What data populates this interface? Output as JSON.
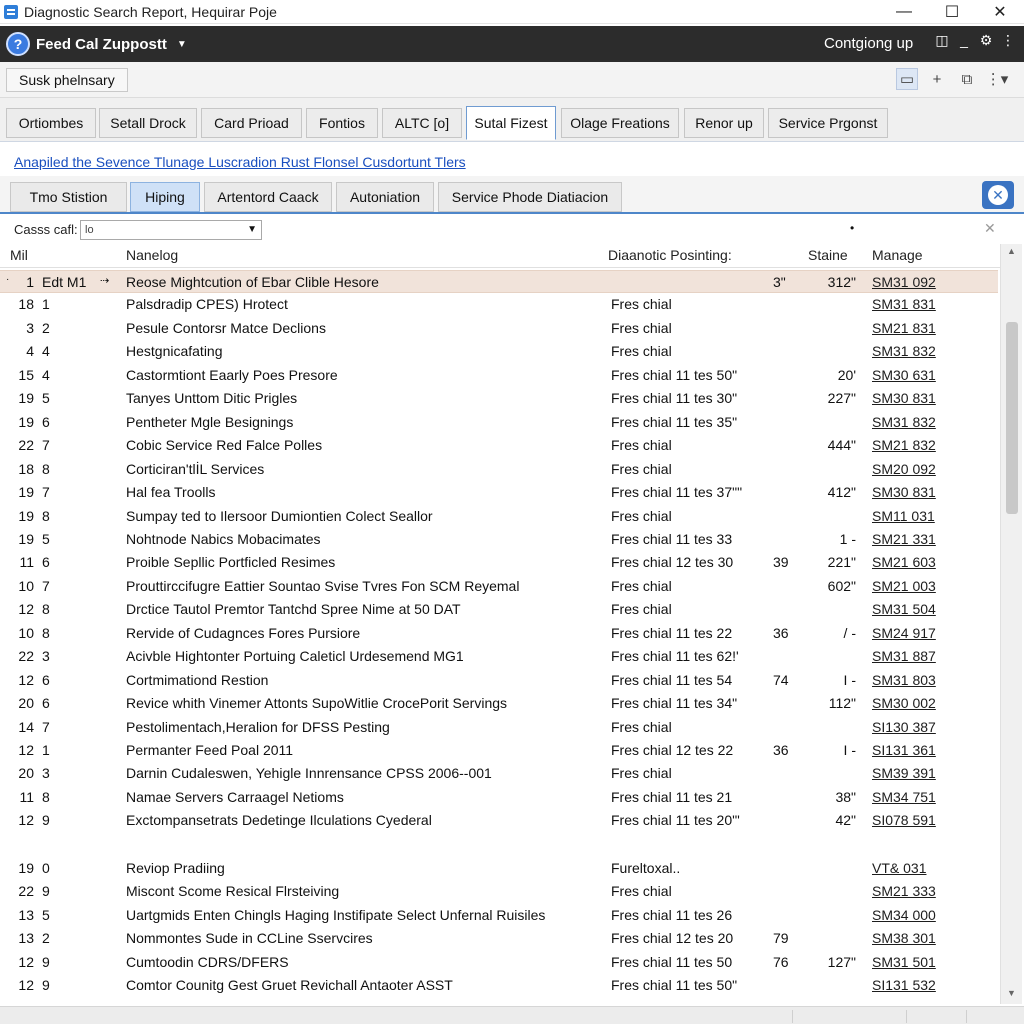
{
  "window": {
    "title": "Diagnostic Search Report, Hequirar Poje",
    "buttons": [
      "—",
      "☐",
      "✕"
    ]
  },
  "appbar": {
    "app_name": "Feed Cal Zuppostt",
    "right_text": "Contgiong up"
  },
  "toolbar": {
    "search_chip": "Susk phelnsary"
  },
  "main_tabs": [
    "Ortiombes",
    "Setall Drock",
    "Card Prioad",
    "Fontios",
    "ALTC [o]",
    "Sutal Fizest",
    "Olage Freations",
    "Renor up",
    "Service Prgonst"
  ],
  "main_tab_active": "Sutal Fizest",
  "link": "Anapiled the Sevence Tlunage Luscradion Rust Flonsel Cusdortunt Tlers",
  "sub_tabs": [
    "Tmo Stistion",
    "Hiping",
    "Artentord Caack",
    "Autoniation",
    "Service Phode Diatiacion"
  ],
  "sub_tab_active": "Hiping",
  "filter": {
    "label": "Casss cafl:",
    "value": "lo"
  },
  "columns": {
    "mil": "Mil",
    "name": "Nanelog",
    "diag": "Diaanotic Posinting:",
    "status": "Staine",
    "manage": "Manage"
  },
  "rows": [
    {
      "a": "1",
      "b": "Edt M1",
      "name": "Reose Mightcution of Ebar Clible Hesore",
      "diag": "",
      "c": "3\"",
      "d": "312\"",
      "manage": "SM31 092"
    },
    {
      "a": "18",
      "b": "1",
      "name": "Palsdradip CPES) Hrotect",
      "diag": "Fres chial",
      "c": "",
      "d": "",
      "manage": "SM31 831"
    },
    {
      "a": "3",
      "b": "2",
      "name": "Pesule Contorsr Matce Declions",
      "diag": "Fres chial",
      "c": "",
      "d": "",
      "manage": "SM21 831"
    },
    {
      "a": "4",
      "b": "4",
      "name": "Hestgnicafating",
      "diag": "Fres chial",
      "c": "",
      "d": "",
      "manage": "SM31 832"
    },
    {
      "a": "15",
      "b": "4",
      "name": "Castormtiont Eaarly Poes Presore",
      "diag": "Fres chial 11 tes 50\"",
      "c": "",
      "d": "20'",
      "manage": "SM30 631"
    },
    {
      "a": "19",
      "b": "5",
      "name": "Tanyes Unttom Ditic Prigles",
      "diag": "Fres chial 11 tes 30\"",
      "c": "",
      "d": "227\"",
      "manage": "SM30 831"
    },
    {
      "a": "19",
      "b": "6",
      "name": "Pentheter Mgle Besignings",
      "diag": "Fres chial 11 tes 35\"",
      "c": "",
      "d": "",
      "manage": "SM31 832"
    },
    {
      "a": "22",
      "b": "7",
      "name": "Cobic Service Red Falce Polles",
      "diag": "Fres chial",
      "c": "",
      "d": "444\"",
      "manage": "SM21 832"
    },
    {
      "a": "18",
      "b": "8",
      "name": "Corticiran'tlİL Services",
      "diag": "Fres chial",
      "c": "",
      "d": "",
      "manage": "SM20 092"
    },
    {
      "a": "19",
      "b": "7",
      "name": "Hal fea Troolls",
      "diag": "Fres chial 11 tes 37\"\"",
      "c": "",
      "d": "412\"",
      "manage": "SM30 831"
    },
    {
      "a": "19",
      "b": "8",
      "name": "Sumpay ted to Ilersoor Dumiontien Colect Seallor",
      "diag": "Fres chial",
      "c": "",
      "d": "",
      "manage": "SM11 031"
    },
    {
      "a": "19",
      "b": "5",
      "name": "Nohtnode Nabics Mobacimates",
      "diag": "Fres chial 11 tes 33",
      "c": "",
      "d": "1 -",
      "manage": "SM21 331"
    },
    {
      "a": "11",
      "b": "6",
      "name": "Proible Sepllic Portficled Resimes",
      "diag": "Fres chial 12 tes 30",
      "c": "39",
      "d": "221\"",
      "manage": "SM21 603"
    },
    {
      "a": "10",
      "b": "7",
      "name": "Prouttirccifugre Eattier Sountao Svise Tvres Fon SCM Reyemal",
      "diag": "Fres chial",
      "c": "",
      "d": "602\"",
      "manage": "SM21 003"
    },
    {
      "a": "12",
      "b": "8",
      "name": "Drctice Tautol Premtor Tantchd Spree Nime at 50 DAT",
      "diag": "Fres chial",
      "c": "",
      "d": "",
      "manage": "SM31 504"
    },
    {
      "a": "10",
      "b": "8",
      "name": "Rervide of Cudagnces Fores Pursiore",
      "diag": "Fres chial 11 tes 22",
      "c": "36",
      "d": "/ -",
      "manage": "SM24 917"
    },
    {
      "a": "22",
      "b": "3",
      "name": "Acivble Hightonter Portuing Caleticl Urdesemend MG1",
      "diag": "Fres chial 11 tes 62!'",
      "c": "",
      "d": "",
      "manage": "SM31 887"
    },
    {
      "a": "12",
      "b": "6",
      "name": "Cortmimationd Restion",
      "diag": "Fres chial 11 tes 54",
      "c": "74",
      "d": "I -",
      "manage": "SM31 803"
    },
    {
      "a": "20",
      "b": "6",
      "name": "Revice whith Vinemer Attonts SupoWitlie CrocePorit Servings",
      "diag": "Fres chial 11 tes 34\"",
      "c": "",
      "d": "112\"",
      "manage": "SM30 002"
    },
    {
      "a": "14",
      "b": "7",
      "name": "Pestolimentach,Heralion for DFSS Pesting",
      "diag": "Fres chial",
      "c": "",
      "d": "",
      "manage": "SI130 387"
    },
    {
      "a": "12",
      "b": "1",
      "name": "Permanter Feed Poal 2011",
      "diag": "Fres chial 12 tes 22",
      "c": "36",
      "d": "I -",
      "manage": "SI131 361"
    },
    {
      "a": "20",
      "b": "3",
      "name": "Darnin Cudaleswen, Yehigle Innrensance CPSS 2006--001",
      "diag": "Fres chial",
      "c": "",
      "d": "",
      "manage": "SM39 391"
    },
    {
      "a": "11",
      "b": "8",
      "name": "Namae Servers Carraagel Netioms",
      "diag": "Fres chial 11 tes 21",
      "c": "",
      "d": "38\"",
      "manage": "SM34 751"
    },
    {
      "a": "12",
      "b": "9",
      "name": "Exctompansetrats Dedetinge Ilculations Cyederal",
      "diag": "Fres chial 11 tes 20'\"",
      "c": "",
      "d": "42\"",
      "manage": "SI078 591"
    },
    {
      "a": "19",
      "b": "0",
      "name": "Reviop Pradiing",
      "diag": "Fureltoxal..",
      "c": "",
      "d": "",
      "manage": "VT&  031"
    },
    {
      "a": "22",
      "b": "9",
      "name": "Miscont Scome Resical Flrsteiving",
      "diag": "Fres chial",
      "c": "",
      "d": "",
      "manage": "SM21 333"
    },
    {
      "a": "13",
      "b": "5",
      "name": "Uartgmids Enten Chingls Haging Instifipate Select Unfernal Ruisiles",
      "diag": "Fres chial 11 tes 26",
      "c": "",
      "d": "",
      "manage": "SM34 000"
    },
    {
      "a": "13",
      "b": "2",
      "name": "Nommontes Sude in CCLine Sservcires",
      "diag": "Fres chial 12 tes 20",
      "c": "79",
      "d": "",
      "manage": "SM38 301"
    },
    {
      "a": "12",
      "b": "9",
      "name": "Cumtoodin CDRS/DFERS",
      "diag": "Fres chial 11 tes 50",
      "c": "76",
      "d": "127\"",
      "manage": "SM31 501"
    },
    {
      "a": "12",
      "b": "9",
      "name": "Comtor Counitg Gest Gruet Revichall Antaoter ASST",
      "diag": "Fres chial 11 tes 50\"",
      "c": "",
      "d": "",
      "manage": "SI131 532"
    }
  ]
}
